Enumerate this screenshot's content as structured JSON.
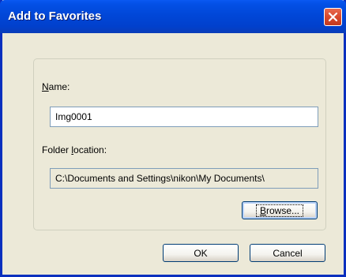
{
  "dialog": {
    "title": "Add to Favorites"
  },
  "name_field": {
    "label_accel": "N",
    "label_rest": "ame:",
    "value": "Img0001"
  },
  "folder_field": {
    "label_prefix": "Folder ",
    "label_accel": "l",
    "label_rest": "ocation:",
    "value": "C:\\Documents and Settings\\nikon\\My Documents\\"
  },
  "buttons": {
    "browse_accel": "B",
    "browse_rest": "rowse...",
    "ok_label": "OK",
    "cancel_label": "Cancel"
  },
  "colors": {
    "titlebar": "#0147d8",
    "close_button": "#d8492d",
    "dialog_background": "#ece9d8"
  },
  "icons": {
    "close": "close-icon"
  }
}
